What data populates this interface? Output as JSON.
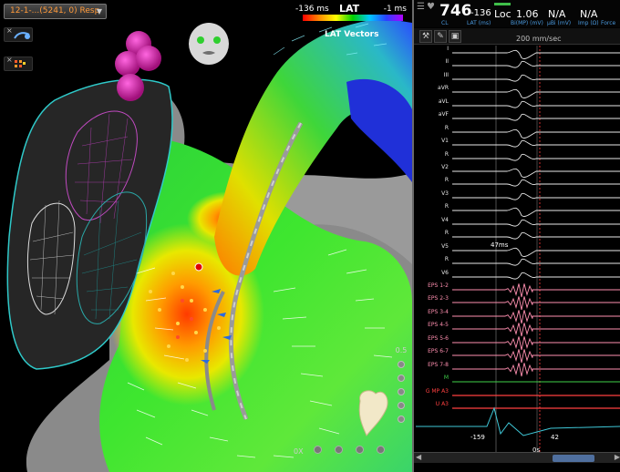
{
  "map": {
    "selector_label": "12-1-...(5241, 0) Resp",
    "legend": {
      "low": "-136 ms",
      "title": "LAT",
      "high": "-1 ms"
    },
    "vectors_label": "LAT Vectors",
    "side_value": "0.5",
    "bottom_value": "0X"
  },
  "ecg": {
    "heart_rate": "746",
    "cl_value": "-136",
    "cl_label": "CL",
    "lat_label": "LAT (ms)",
    "loc_label": "Loc",
    "bi_value": "1.06",
    "bi_label": "Bi(MP) (mV)",
    "uni_value": "N/A",
    "uni_label": "μBi (mV)",
    "imp_value": "N/A",
    "imp_label": "Imp (Ω)",
    "force_label": "Force",
    "speed": "200 mm/sec",
    "marker_ms": "47ms",
    "axis_left": "-159",
    "axis_zero": "0s",
    "axis_right": "42",
    "traces": [
      {
        "label": "I",
        "kind": "w"
      },
      {
        "label": "II",
        "kind": "w"
      },
      {
        "label": "III",
        "kind": "w"
      },
      {
        "label": "aVR",
        "kind": "w"
      },
      {
        "label": "aVL",
        "kind": "w"
      },
      {
        "label": "aVF",
        "kind": "w"
      },
      {
        "label": "R",
        "kind": "w"
      },
      {
        "label": "V1",
        "kind": "w"
      },
      {
        "label": "R",
        "kind": "w"
      },
      {
        "label": "V2",
        "kind": "w"
      },
      {
        "label": "R",
        "kind": "w"
      },
      {
        "label": "V3",
        "kind": "w"
      },
      {
        "label": "R",
        "kind": "w"
      },
      {
        "label": "V4",
        "kind": "w"
      },
      {
        "label": "R",
        "kind": "w"
      },
      {
        "label": "V5",
        "kind": "w"
      },
      {
        "label": "R",
        "kind": "w"
      },
      {
        "label": "V6",
        "kind": "w"
      },
      {
        "label": "EPS 1-2",
        "kind": "p"
      },
      {
        "label": "EPS 2-3",
        "kind": "p"
      },
      {
        "label": "EPS 3-4",
        "kind": "p"
      },
      {
        "label": "EPS 4-5",
        "kind": "p"
      },
      {
        "label": "EPS 5-6",
        "kind": "p"
      },
      {
        "label": "EPS 6-7",
        "kind": "p"
      },
      {
        "label": "EPS 7-8",
        "kind": "p"
      },
      {
        "label": "M",
        "kind": "g"
      },
      {
        "label": "G MP A3",
        "kind": "r"
      },
      {
        "label": "U A3",
        "kind": "r"
      }
    ]
  }
}
